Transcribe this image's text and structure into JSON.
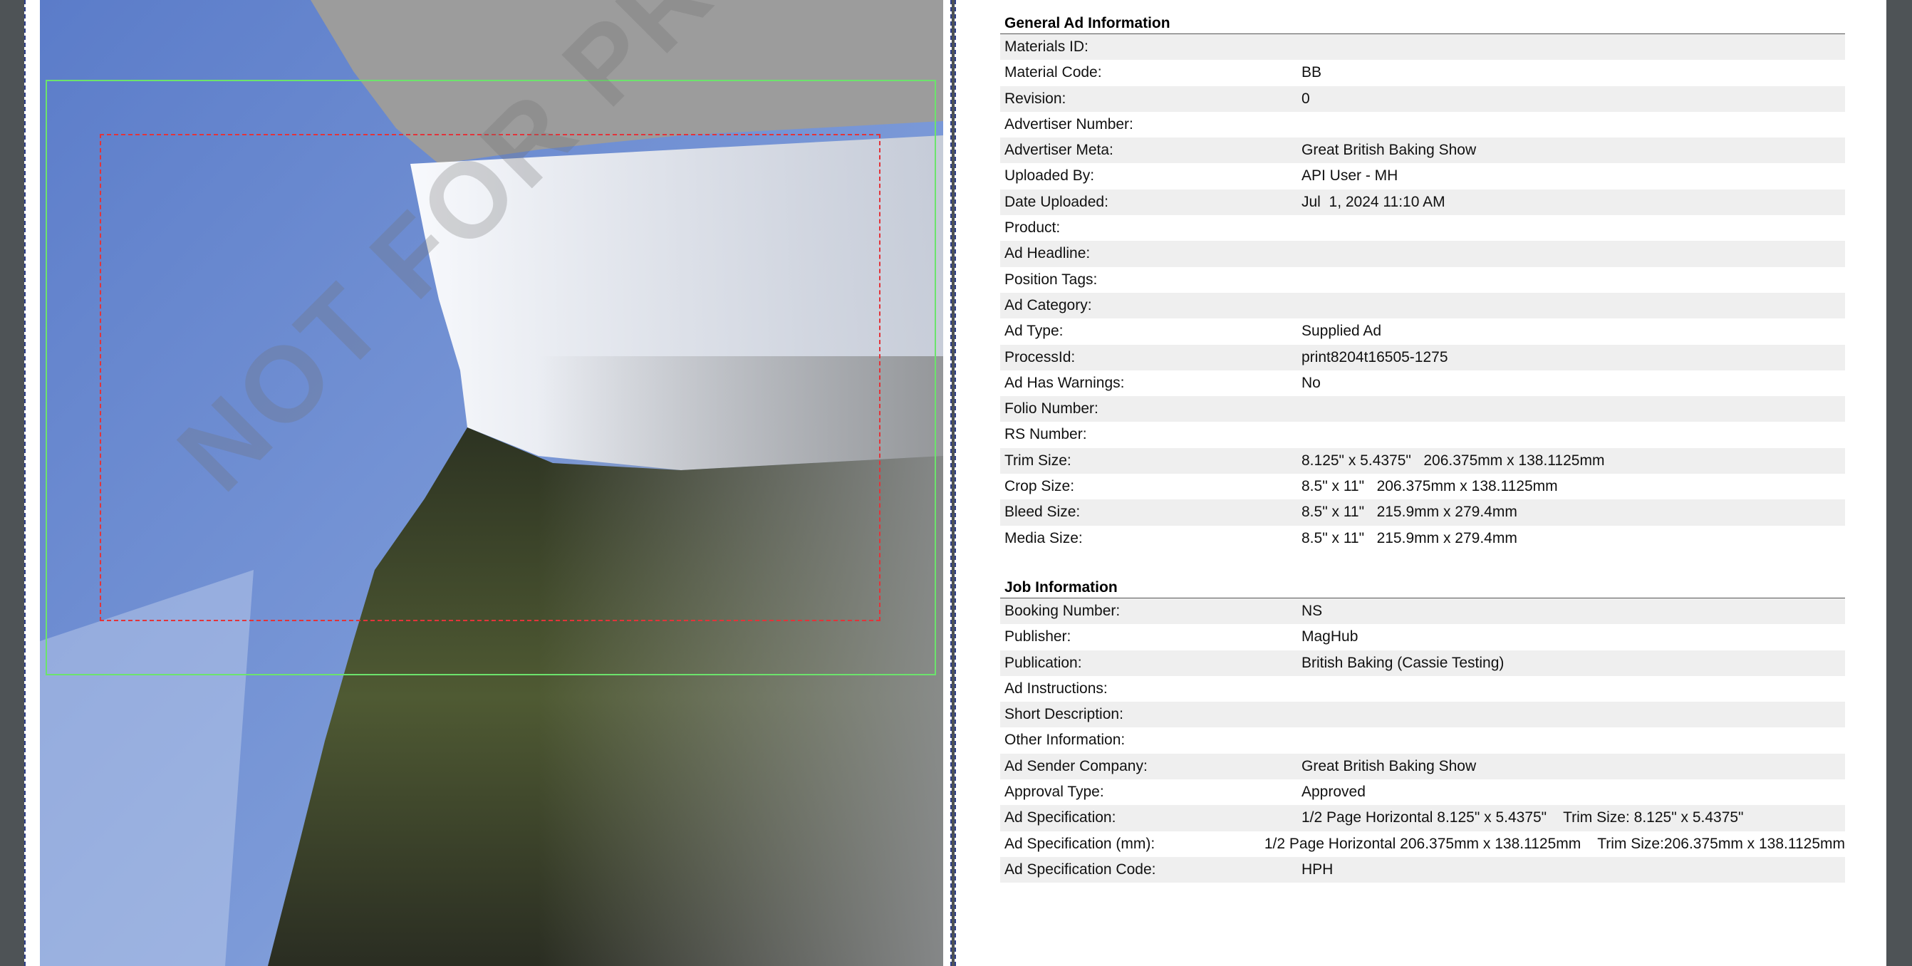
{
  "watermark": "NOT FOR PRINT",
  "sections": [
    {
      "title": "General Ad Information",
      "rows": [
        {
          "label": "Materials ID:",
          "value": ""
        },
        {
          "label": "Material Code:",
          "value": "BB"
        },
        {
          "label": "Revision:",
          "value": "0"
        },
        {
          "label": "Advertiser Number:",
          "value": ""
        },
        {
          "label": "Advertiser Meta:",
          "value": "Great British Baking Show"
        },
        {
          "label": "Uploaded By:",
          "value": "API User - MH"
        },
        {
          "label": "Date Uploaded:",
          "value": "Jul  1, 2024 11:10 AM"
        },
        {
          "label": "Product:",
          "value": ""
        },
        {
          "label": "Ad Headline:",
          "value": ""
        },
        {
          "label": "Position Tags:",
          "value": ""
        },
        {
          "label": "Ad Category:",
          "value": ""
        },
        {
          "label": "Ad Type:",
          "value": "Supplied Ad"
        },
        {
          "label": "ProcessId:",
          "value": "print8204t16505-1275"
        },
        {
          "label": "Ad Has Warnings:",
          "value": "No"
        },
        {
          "label": "Folio Number:",
          "value": ""
        },
        {
          "label": "RS Number:",
          "value": ""
        },
        {
          "label": "Trim Size:",
          "value": "8.125\" x 5.4375\"   206.375mm x 138.1125mm"
        },
        {
          "label": "Crop Size:",
          "value": "8.5\" x 11\"   206.375mm x 138.1125mm"
        },
        {
          "label": "Bleed Size:",
          "value": "8.5\" x 11\"   215.9mm x 279.4mm"
        },
        {
          "label": "Media Size:",
          "value": "8.5\" x 11\"   215.9mm x 279.4mm"
        }
      ]
    },
    {
      "title": "Job Information",
      "rows": [
        {
          "label": "Booking Number:",
          "value": "NS"
        },
        {
          "label": "Publisher:",
          "value": "MagHub"
        },
        {
          "label": "Publication:",
          "value": "British Baking (Cassie Testing)"
        },
        {
          "label": "Ad Instructions:",
          "value": ""
        },
        {
          "label": "Short Description:",
          "value": ""
        },
        {
          "label": "Other Information:",
          "value": ""
        },
        {
          "label": "Ad Sender Company:",
          "value": "Great British Baking Show"
        },
        {
          "label": "Approval Type:",
          "value": "Approved"
        },
        {
          "label": "Ad Specification:",
          "value": "1/2 Page Horizontal 8.125\" x 5.4375\"    Trim Size: 8.125\" x 5.4375\""
        },
        {
          "label": "Ad Specification (mm):",
          "value": "1/2 Page Horizontal 206.375mm x 138.1125mm    Trim Size:206.375mm x 138.1125mm"
        },
        {
          "label": "Ad Specification Code:",
          "value": "HPH"
        }
      ]
    }
  ]
}
